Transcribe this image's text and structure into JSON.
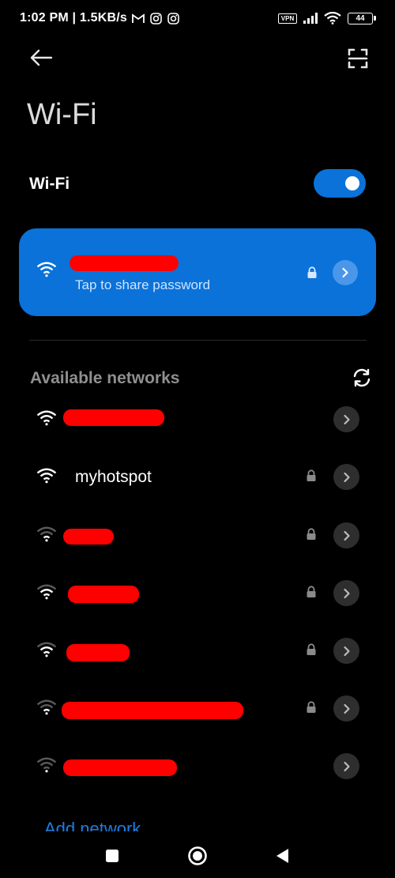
{
  "status_bar": {
    "time": "1:02 PM",
    "separator": "|",
    "speed": "1.5KB/s",
    "notification_icons": [
      "gmail-icon",
      "instagram-icon",
      "instagram-icon"
    ],
    "vpn": "VPN",
    "battery": "44"
  },
  "header": {
    "title": "Wi-Fi",
    "back_icon": "arrow-left-icon",
    "scan_icon": "qr-scan-icon"
  },
  "wifi_toggle": {
    "label": "Wi-Fi",
    "enabled": true
  },
  "connected_network": {
    "name": "",
    "status": "Tap to share password",
    "secured": true
  },
  "available_networks": {
    "title": "Available networks",
    "items": [
      {
        "name": "",
        "secured": false,
        "signal": 4
      },
      {
        "name": "myhotspot",
        "secured": true,
        "signal": 4
      },
      {
        "name": "",
        "secured": true,
        "signal": 2
      },
      {
        "name": "",
        "secured": true,
        "signal": 2
      },
      {
        "name": "",
        "secured": true,
        "signal": 3
      },
      {
        "name": "",
        "secured": true,
        "signal": 2
      },
      {
        "name": "",
        "secured": false,
        "signal": 1
      }
    ]
  },
  "add_network_label": "Add network",
  "colors": {
    "accent": "#0a72d9",
    "background": "#000000",
    "section": "#8f8f8f",
    "link": "#1f7de0",
    "redaction": "#ff0000"
  }
}
